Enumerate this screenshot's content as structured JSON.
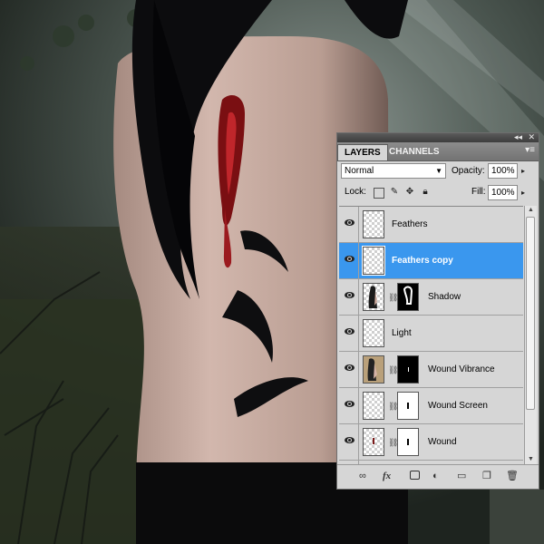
{
  "panel": {
    "tabs": [
      {
        "label": "LAYERS"
      },
      {
        "label": "CHANNELS"
      }
    ],
    "blend_mode": "Normal",
    "opacity_label": "Opacity:",
    "opacity_value": "100%",
    "lock_label": "Lock:",
    "fill_label": "Fill:",
    "fill_value": "100%",
    "layers": [
      {
        "name": "Feathers",
        "visible": true,
        "selected": false,
        "has_mask": false
      },
      {
        "name": "Feathers copy",
        "visible": true,
        "selected": true,
        "has_mask": false
      },
      {
        "name": "Shadow",
        "visible": true,
        "selected": false,
        "has_mask": true
      },
      {
        "name": "Light",
        "visible": true,
        "selected": false,
        "has_mask": false
      },
      {
        "name": "Wound Vibrance",
        "visible": true,
        "selected": false,
        "has_mask": true
      },
      {
        "name": "Wound Screen",
        "visible": true,
        "selected": false,
        "has_mask": true
      },
      {
        "name": "Wound",
        "visible": true,
        "selected": false,
        "has_mask": true
      }
    ],
    "bottom_icons": [
      "link-icon",
      "fx-icon",
      "mask-icon",
      "adjustment-icon",
      "folder-icon",
      "new-layer-icon",
      "trash-icon"
    ]
  },
  "colors": {
    "selection": "#3a97ee",
    "panel_bg": "#d6d6d6"
  }
}
